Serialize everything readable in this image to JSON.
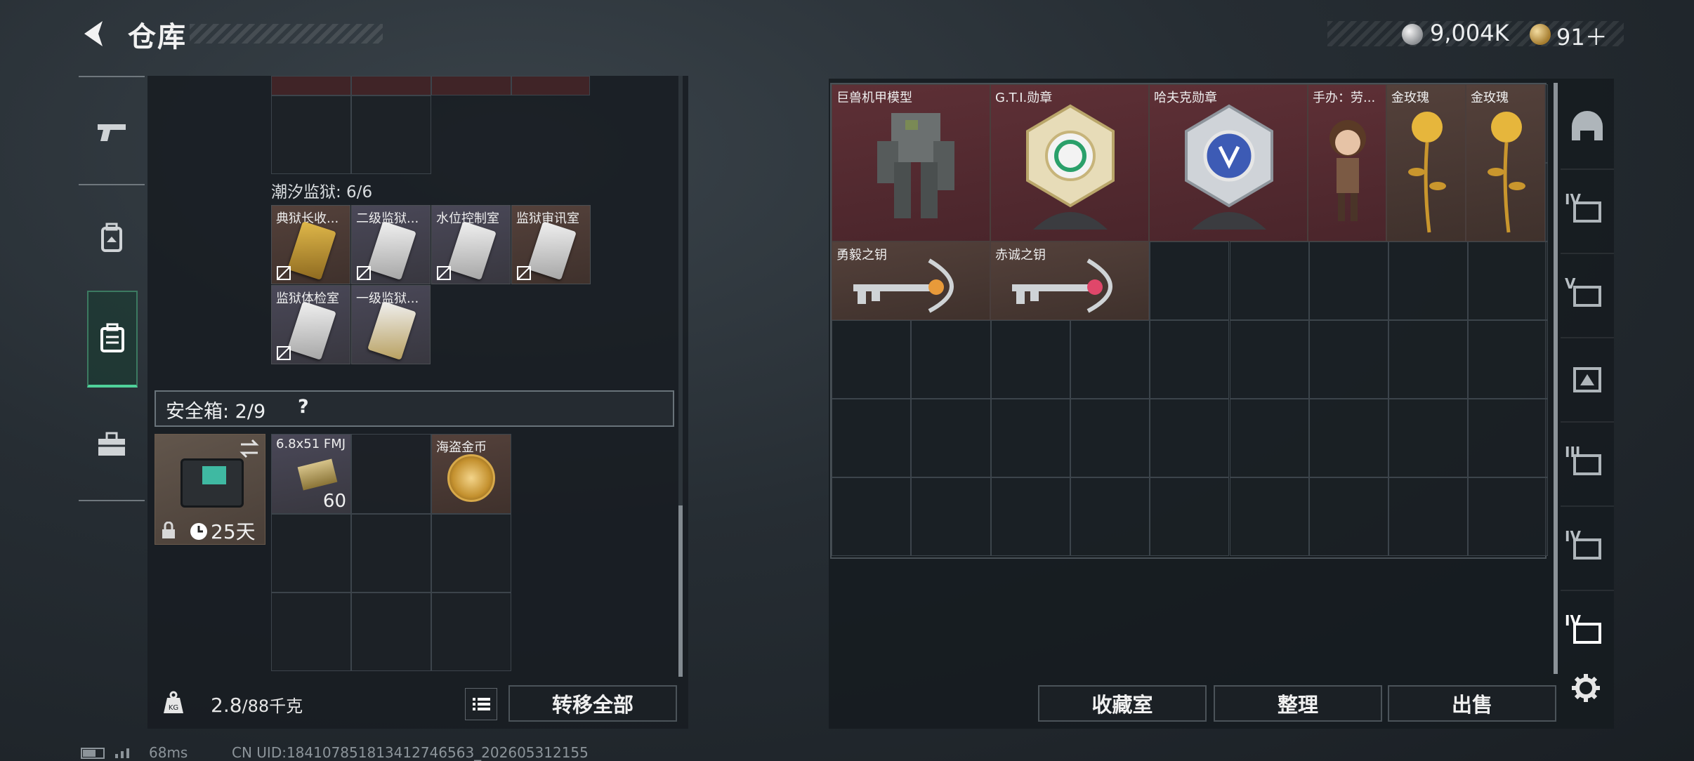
{
  "header": {
    "title": "仓库",
    "silver_amount": "9,004K",
    "gold_amount": "91＋"
  },
  "left_nav": {
    "items": [
      {
        "name": "weapons",
        "icon": "pistol-icon"
      },
      {
        "name": "armor",
        "icon": "backpack-icon"
      },
      {
        "name": "containers",
        "icon": "case-icon",
        "active": true
      },
      {
        "name": "tools",
        "icon": "toolbox-icon"
      }
    ]
  },
  "prison": {
    "section_label": "潮汐监狱: 6/6",
    "cards": [
      {
        "label": "典狱长收...",
        "color": "#c29a3a"
      },
      {
        "label": "二级监狱...",
        "color": "#c7c7c7"
      },
      {
        "label": "水位控制室",
        "color": "#c7c7c7"
      },
      {
        "label": "监狱审讯室",
        "color": "#c7c7c7"
      },
      {
        "label": "监狱体检室",
        "color": "#c7c7c7"
      },
      {
        "label": "一级监狱...",
        "color": "#c7c7c7"
      }
    ]
  },
  "safebox": {
    "label": "安全箱: 2/9",
    "help": "?",
    "time": "25天",
    "ammo_label": "6.8x51 FMJ",
    "ammo_count": "60",
    "coin_label": "海盗金币"
  },
  "bottom": {
    "weight_current": "2.8",
    "weight_total": "/88千克",
    "transfer_all": "转移全部",
    "collection": "收藏室",
    "sort": "整理",
    "sell": "出售"
  },
  "stash": {
    "items": [
      {
        "label": "巨兽机甲模型"
      },
      {
        "label": "G.T.I.勋章"
      },
      {
        "label": "哈夫克勋章"
      },
      {
        "label": "手办：劳..."
      },
      {
        "label": "金玫瑰"
      },
      {
        "label": "金玫瑰"
      },
      {
        "label": "勇毅之钥"
      },
      {
        "label": "赤诚之钥"
      }
    ]
  },
  "filters": [
    "IV",
    "V",
    "",
    "III",
    "IV",
    "IV"
  ],
  "status": {
    "ping": "68ms",
    "uid": "CN UID:184107851813412746563_202605312155"
  },
  "colors": {
    "accent_green": "#4fd19a",
    "item_red": "#5e3036",
    "item_brown": "#54413b"
  }
}
